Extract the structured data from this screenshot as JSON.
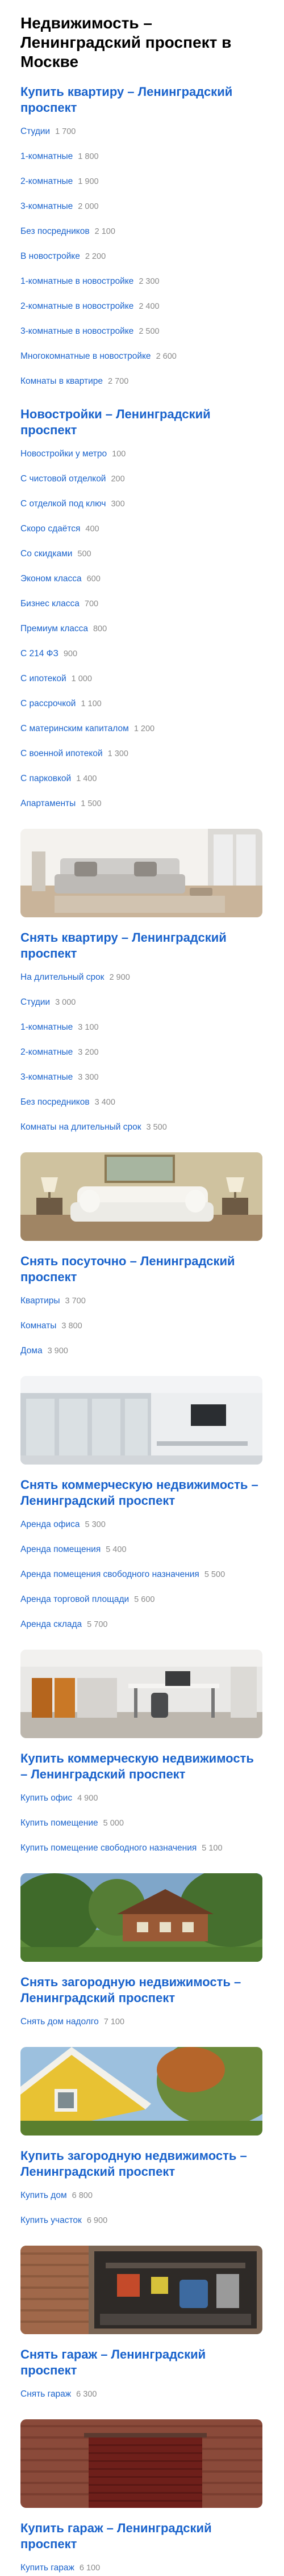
{
  "page_title": "Недвижимость – Ленинградский проспект в Москве",
  "sections": [
    {
      "title": "Купить квартиру – Ленинградский проспект",
      "image": null,
      "links": [
        {
          "label": "Студии",
          "count": "1 700"
        },
        {
          "label": "1-комнатные",
          "count": "1 800"
        },
        {
          "label": "2-комнатные",
          "count": "1 900"
        },
        {
          "label": "3-комнатные",
          "count": "2 000"
        },
        {
          "label": "Без посредников",
          "count": "2 100"
        },
        {
          "label": "В новостройке",
          "count": "2 200"
        },
        {
          "label": "1-комнатные в новостройке",
          "count": "2 300"
        },
        {
          "label": "2-комнатные в новостройке",
          "count": "2 400"
        },
        {
          "label": "3-комнатные в новостройке",
          "count": "2 500"
        },
        {
          "label": "Многокомнатные в новостройке",
          "count": "2 600"
        },
        {
          "label": "Комнаты в квартире",
          "count": "2 700"
        }
      ]
    },
    {
      "title": "Новостройки – Ленинградский проспект",
      "image": null,
      "links": [
        {
          "label": "Новостройки у метро",
          "count": "100"
        },
        {
          "label": "С чистовой отделкой",
          "count": "200"
        },
        {
          "label": "С отделкой под ключ",
          "count": "300"
        },
        {
          "label": "Скоро сдаётся",
          "count": "400"
        },
        {
          "label": "Со скидками",
          "count": "500"
        },
        {
          "label": "Эконом класса",
          "count": "600"
        },
        {
          "label": "Бизнес класса",
          "count": "700"
        },
        {
          "label": "Премиум класса",
          "count": "800"
        },
        {
          "label": "С 214 ФЗ",
          "count": "900"
        },
        {
          "label": "С ипотекой",
          "count": "1 000"
        },
        {
          "label": "С рассрочкой",
          "count": "1 100"
        },
        {
          "label": "С материнским капиталом",
          "count": "1 200"
        },
        {
          "label": "С военной ипотекой",
          "count": "1 300"
        },
        {
          "label": "С парковкой",
          "count": "1 400"
        },
        {
          "label": "Апартаменты",
          "count": "1 500"
        }
      ]
    },
    {
      "title": "Снять квартиру – Ленинградский проспект",
      "image": "living-room-photo",
      "links": [
        {
          "label": "На длительный срок",
          "count": "2 900"
        },
        {
          "label": "Студии",
          "count": "3 000"
        },
        {
          "label": "1-комнатные",
          "count": "3 100"
        },
        {
          "label": "2-комнатные",
          "count": "3 200"
        },
        {
          "label": "3-комнатные",
          "count": "3 300"
        },
        {
          "label": "Без посредников",
          "count": "3 400"
        },
        {
          "label": "Комнаты на длительный срок",
          "count": "3 500"
        }
      ]
    },
    {
      "title": "Снять посуточно – Ленинградский проспект",
      "image": "sofa-room-photo",
      "links": [
        {
          "label": "Квартиры",
          "count": "3 700"
        },
        {
          "label": "Комнаты",
          "count": "3 800"
        },
        {
          "label": "Дома",
          "count": "3 900"
        }
      ]
    },
    {
      "title": "Снять коммерческую недвижимость – Ленинградский проспект",
      "image": "office-room-photo",
      "links": [
        {
          "label": "Аренда офиса",
          "count": "5 300"
        },
        {
          "label": "Аренда помещения",
          "count": "5 400"
        },
        {
          "label": "Аренда помещения свободного назначения",
          "count": "5 500"
        },
        {
          "label": "Аренда торговой площади",
          "count": "5 600"
        },
        {
          "label": "Аренда склада",
          "count": "5 700"
        }
      ]
    },
    {
      "title": "Купить коммерческую недвижимость – Ленинградский проспект",
      "image": "workspace-photo",
      "links": [
        {
          "label": "Купить офис",
          "count": "4 900"
        },
        {
          "label": "Купить помещение",
          "count": "5 000"
        },
        {
          "label": "Купить помещение свободного назначения",
          "count": "5 100"
        }
      ]
    },
    {
      "title": "Снять загородную недвижимость – Ленинградский проспект",
      "image": "country-house-photo",
      "links": [
        {
          "label": "Снять дом надолго",
          "count": "7 100"
        }
      ]
    },
    {
      "title": "Купить загородную недвижимость – Ленинградский проспект",
      "image": "yellow-house-photo",
      "links": [
        {
          "label": "Купить дом",
          "count": "6 800"
        },
        {
          "label": "Купить участок",
          "count": "6 900"
        }
      ]
    },
    {
      "title": "Снять гараж – Ленинградский проспект",
      "image": "garage-interior-photo",
      "links": [
        {
          "label": "Снять гараж",
          "count": "6 300"
        }
      ]
    },
    {
      "title": "Купить гараж – Ленинградский проспект",
      "image": "garage-door-photo",
      "links": [
        {
          "label": "Купить гараж",
          "count": "6 100"
        }
      ]
    }
  ]
}
